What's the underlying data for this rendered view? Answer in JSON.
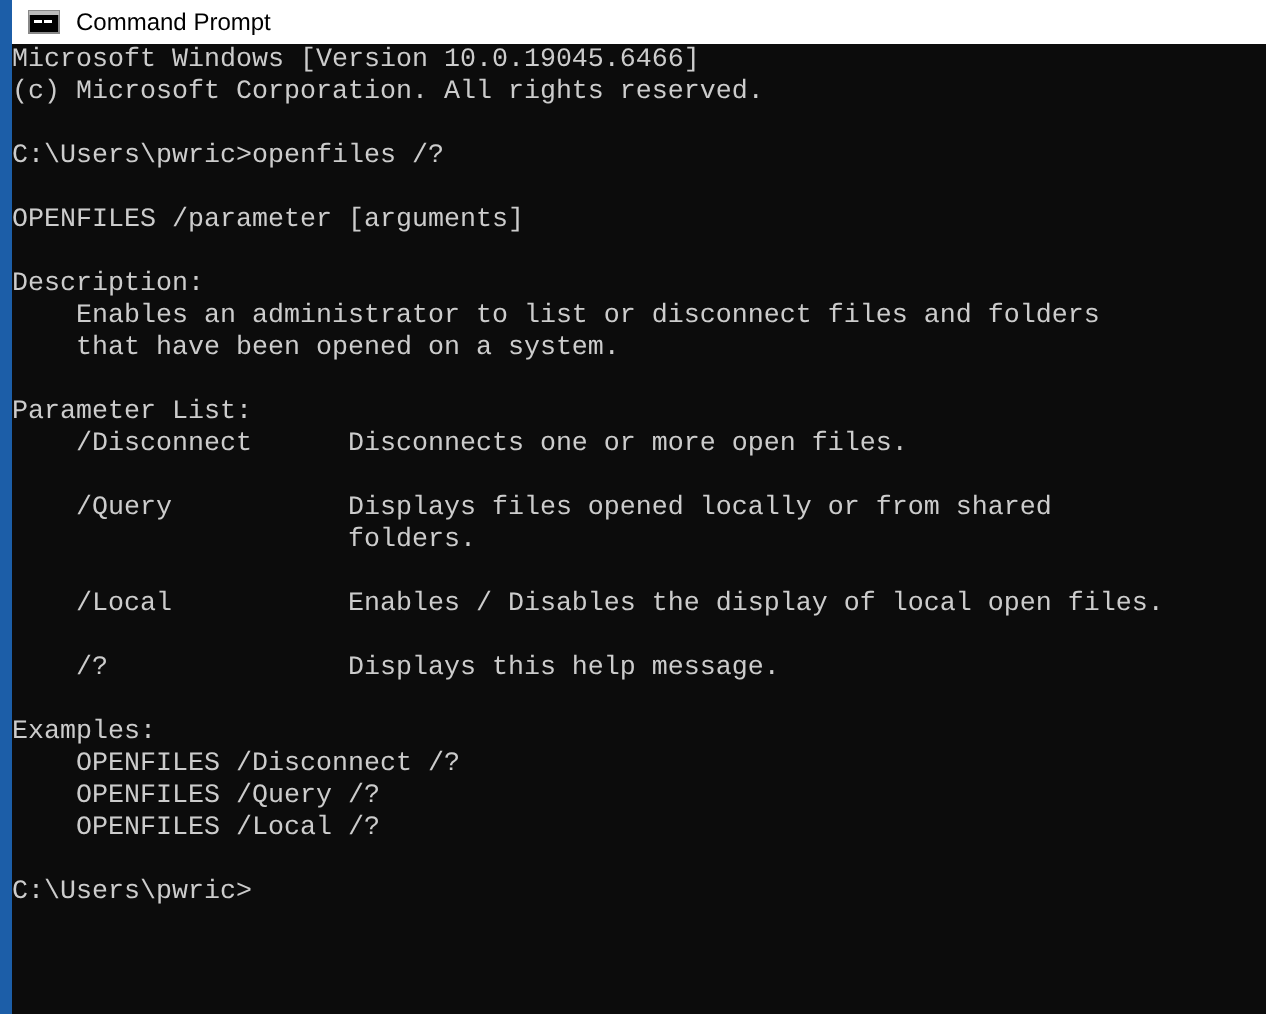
{
  "window": {
    "title": "Command Prompt"
  },
  "console": {
    "lines": [
      {
        "kind": "text",
        "text": "Microsoft Windows [Version 10.0.19045.6466]"
      },
      {
        "kind": "text",
        "text": "(c) Microsoft Corporation. All rights reserved."
      },
      {
        "kind": "blank"
      },
      {
        "kind": "text",
        "text": "C:\\Users\\pwric>openfiles /?"
      },
      {
        "kind": "blank"
      },
      {
        "kind": "text",
        "text": "OPENFILES /parameter [arguments]"
      },
      {
        "kind": "blank"
      },
      {
        "kind": "text",
        "text": "Description:"
      },
      {
        "kind": "text",
        "text": "    Enables an administrator to list or disconnect files and folders"
      },
      {
        "kind": "text",
        "text": "    that have been opened on a system."
      },
      {
        "kind": "blank"
      },
      {
        "kind": "text",
        "text": "Parameter List:"
      },
      {
        "kind": "text",
        "text": "    /Disconnect      Disconnects one or more open files."
      },
      {
        "kind": "blank"
      },
      {
        "kind": "text",
        "text": "    /Query           Displays files opened locally or from shared"
      },
      {
        "kind": "text",
        "text": "                     folders."
      },
      {
        "kind": "blank"
      },
      {
        "kind": "text",
        "text": "    /Local           Enables / Disables the display of local open files."
      },
      {
        "kind": "blank"
      },
      {
        "kind": "text",
        "text": "    /?               Displays this help message."
      },
      {
        "kind": "blank"
      },
      {
        "kind": "text",
        "text": "Examples:"
      },
      {
        "kind": "text",
        "text": "    OPENFILES /Disconnect /?"
      },
      {
        "kind": "text",
        "text": "    OPENFILES /Query /?"
      },
      {
        "kind": "text",
        "text": "    OPENFILES /Local /?"
      },
      {
        "kind": "blank"
      },
      {
        "kind": "text",
        "text": "C:\\Users\\pwric>"
      }
    ]
  }
}
